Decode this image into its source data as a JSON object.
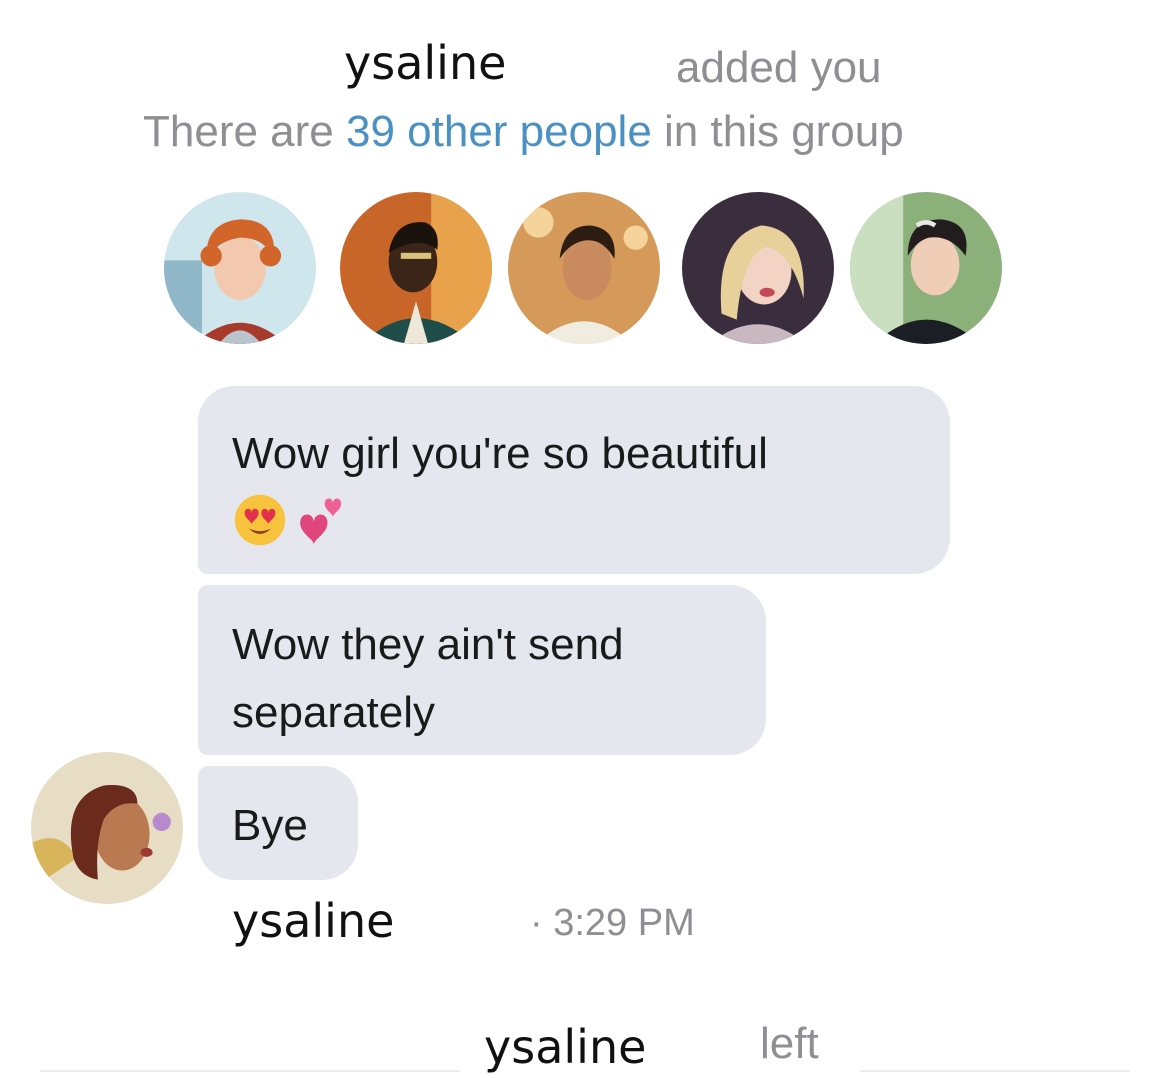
{
  "system_added": {
    "name": "ysaline",
    "text": "added you"
  },
  "group_info": {
    "prefix": "There are ",
    "link": "39 other people",
    "suffix": " in this group"
  },
  "group_avatars": [
    {
      "name": "avatar-redhead"
    },
    {
      "name": "avatar-glasses"
    },
    {
      "name": "avatar-ponytail"
    },
    {
      "name": "avatar-blonde"
    },
    {
      "name": "avatar-darkhair"
    }
  ],
  "messages": [
    {
      "text": "Wow girl you're so beautiful",
      "emoji": [
        "smiling-hearts-eyes",
        "two-hearts"
      ]
    },
    {
      "text_line1": "Wow they ain't send",
      "text_line2": "separately"
    },
    {
      "text": "Bye"
    }
  ],
  "sender": {
    "name": "ysaline",
    "time": "· 3:29 PM"
  },
  "system_left": {
    "name": "ysaline",
    "text": "left"
  },
  "colors": {
    "bubble": "#e6e7ee",
    "link": "#4a90c2",
    "meta": "#8e8e93"
  }
}
